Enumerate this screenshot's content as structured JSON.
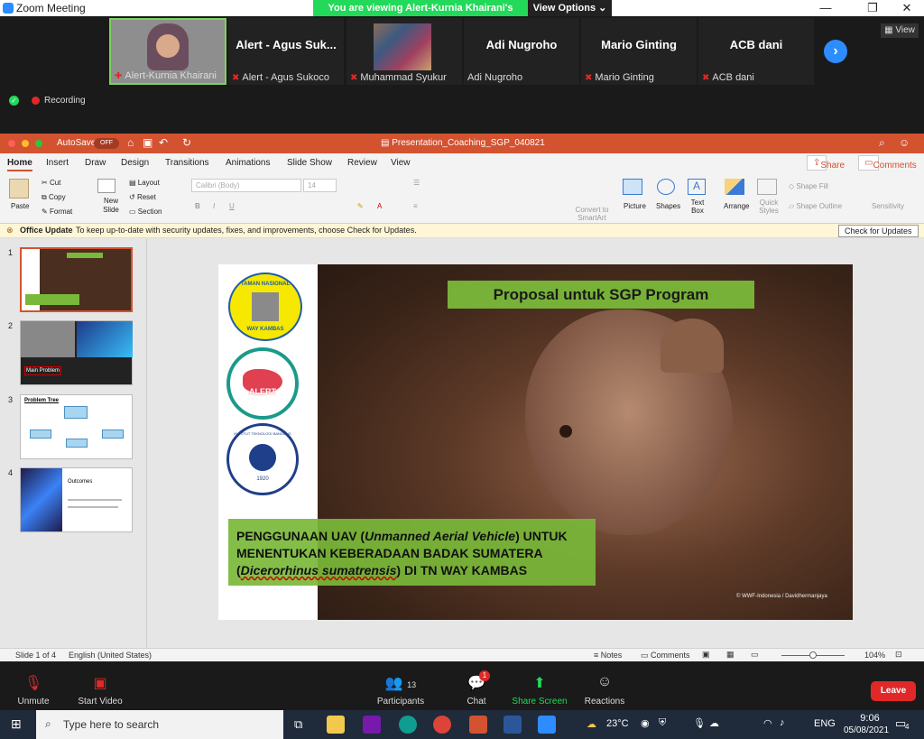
{
  "zoom": {
    "title": "Zoom Meeting",
    "banner": "You are viewing Alert-Kurnia Khairani's screen",
    "view_options": "View Options",
    "view_button": "View",
    "recording": "Recording",
    "participants_tiles": [
      {
        "name": "Alert-Kurnia Khairani",
        "big": ""
      },
      {
        "name": "Alert - Agus Sukoco",
        "big": "Alert - Agus Suk..."
      },
      {
        "name": "Muhammad Syukur",
        "big": ""
      },
      {
        "name": "Adi Nugroho",
        "big": "Adi Nugroho"
      },
      {
        "name": "Mario Ginting",
        "big": "Mario Ginting"
      },
      {
        "name": "ACB dani",
        "big": "ACB dani"
      }
    ],
    "controls": {
      "unmute": "Unmute",
      "start_video": "Start Video",
      "participants": "Participants",
      "participants_count": "13",
      "chat": "Chat",
      "chat_badge": "1",
      "share_screen": "Share Screen",
      "reactions": "Reactions",
      "leave": "Leave"
    }
  },
  "ppt": {
    "autosave": "AutoSave",
    "autosave_state": "OFF",
    "filename": "Presentation_Coaching_SGP_040821",
    "tabs": [
      "Home",
      "Insert",
      "Draw",
      "Design",
      "Transitions",
      "Animations",
      "Slide Show",
      "Review",
      "View"
    ],
    "share": "Share",
    "comments": "Comments",
    "ribbon": {
      "paste": "Paste",
      "cut": "Cut",
      "copy": "Copy",
      "format": "Format",
      "new_slide": "New Slide",
      "layout": "Layout",
      "reset": "Reset",
      "section": "Section",
      "font_name": "Calibri (Body)",
      "font_size": "14",
      "convert_smartart": "Convert to SmartArt",
      "picture": "Picture",
      "shapes": "Shapes",
      "text_box": "Text Box",
      "arrange": "Arrange",
      "quick_styles": "Quick Styles",
      "shape_fill": "Shape Fill",
      "shape_outline": "Shape Outline",
      "sensitivity": "Sensitivity"
    },
    "update_bar": {
      "title": "Office Update",
      "message": "To keep up-to-date with security updates, fixes, and improvements, choose Check for Updates.",
      "button": "Check for Updates"
    },
    "slides": [
      "1",
      "2",
      "3",
      "4"
    ],
    "slide": {
      "logo1_top": "TAMAN NASIONAL",
      "logo1_bottom": "WAY KAMBAS",
      "logo2": "ALERT",
      "logo3_text": "INSTITUT TEKNOLOGI BANDUNG",
      "logo3_year": "1920",
      "title": "Proposal untuk SGP Program",
      "body_line1_a": "PENGGUNAAN UAV (",
      "body_line1_b": "Unmanned Aerial Vehicle",
      "body_line1_c": ") UNTUK",
      "body_line2": "MENENTUKAN KEBERADAAN BADAK SUMATERA",
      "body_line3_a": "(",
      "body_line3_b": "Dicerorhinus sumatrensis",
      "body_line3_c": ") DI TN WAY KAMBAS",
      "credit": "© WWF-Indonesia / Davidhermanjaya"
    },
    "thumb_texts": {
      "t2_label": "Main Problem",
      "t3_label": "Problem Tree",
      "t4_label": "Outcomes"
    },
    "status": {
      "slide_of": "Slide 1 of 4",
      "language": "English (United States)",
      "notes": "Notes",
      "comments": "Comments",
      "zoom": "104%"
    }
  },
  "taskbar": {
    "search": "Type here to search",
    "weather": "23°C",
    "lang": "ENG",
    "time": "9:06",
    "date": "05/08/2021",
    "notif": "4"
  }
}
